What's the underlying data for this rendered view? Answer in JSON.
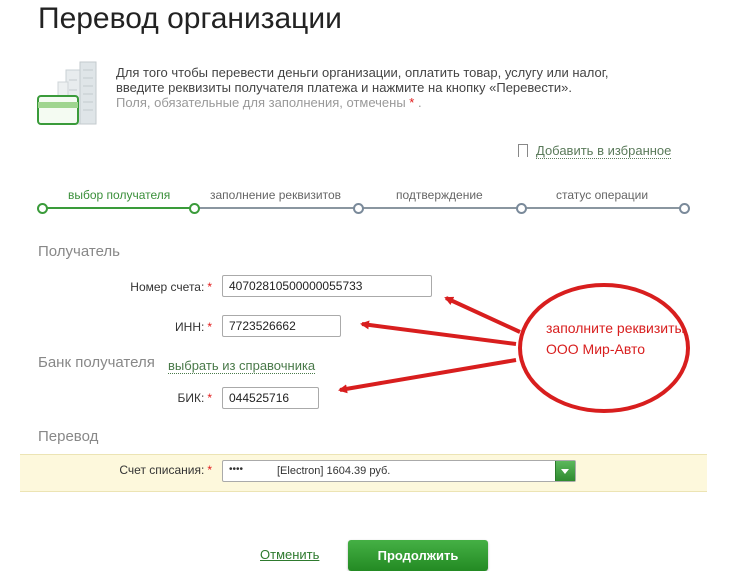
{
  "page": {
    "title": "Перевод организации"
  },
  "intro": {
    "line1": "Для того чтобы перевести деньги организации, оплатить товар, услугу или налог,",
    "line2": "введите реквизиты получателя платежа и нажмите на кнопку «Перевести».",
    "hint": "Поля, обязательные для заполнения, отмечены",
    "star": "*",
    "tail": "."
  },
  "favorites": {
    "label": "Добавить в избранное"
  },
  "steps": [
    {
      "label": "выбор получателя",
      "active": true
    },
    {
      "label": "заполнение реквизитов",
      "active": false
    },
    {
      "label": "подтверждение",
      "active": false
    },
    {
      "label": "статус операции",
      "active": false
    }
  ],
  "recipient": {
    "section": "Получатель",
    "account_label": "Номер счета:",
    "account_value": "40702810500000055733",
    "inn_label": "ИНН:",
    "inn_value": "7723526662"
  },
  "bank": {
    "section": "Банк получателя",
    "choose_link": "выбрать из справочника",
    "bik_label": "БИК:",
    "bik_value": "044525716"
  },
  "transfer": {
    "section": "Перевод",
    "debit_label": "Счет списания:",
    "debit_mask": "••••",
    "debit_value": "[Electron] 1604.39 руб."
  },
  "required_star": "*",
  "actions": {
    "cancel": "Отменить",
    "continue": "Продолжить"
  },
  "annotation": {
    "text": "заполните реквизиты ООО Мир-Авто"
  },
  "colors": {
    "accent": "#3a9b3a",
    "annotation": "#d81e1e",
    "band": "#fdf8dc"
  }
}
